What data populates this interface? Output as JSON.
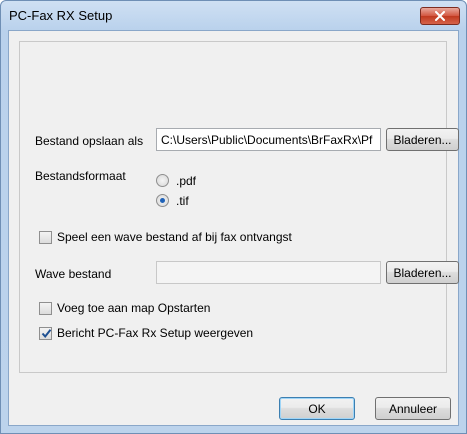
{
  "window": {
    "title": "PC-Fax RX Setup"
  },
  "save_as": {
    "label": "Bestand opslaan als",
    "value": "C:\\Users\\Public\\Documents\\BrFaxRx\\Pf",
    "browse_label": "Bladeren..."
  },
  "file_format": {
    "label": "Bestandsformaat",
    "options": [
      {
        "label": ".pdf",
        "checked": false
      },
      {
        "label": ".tif",
        "checked": true
      }
    ]
  },
  "play_wave": {
    "label": "Speel een wave bestand af bij fax ontvangst",
    "checked": false
  },
  "wave_file": {
    "label": "Wave bestand",
    "value": "",
    "browse_label": "Bladeren..."
  },
  "startup": {
    "label": "Voeg toe aan map Opstarten",
    "checked": false
  },
  "show_message": {
    "label": "Bericht PC-Fax Rx Setup weergeven",
    "checked": true
  },
  "buttons": {
    "ok": "OK",
    "cancel": "Annuleer"
  },
  "icons": {
    "close": "close-icon",
    "check": "checkmark-icon"
  }
}
